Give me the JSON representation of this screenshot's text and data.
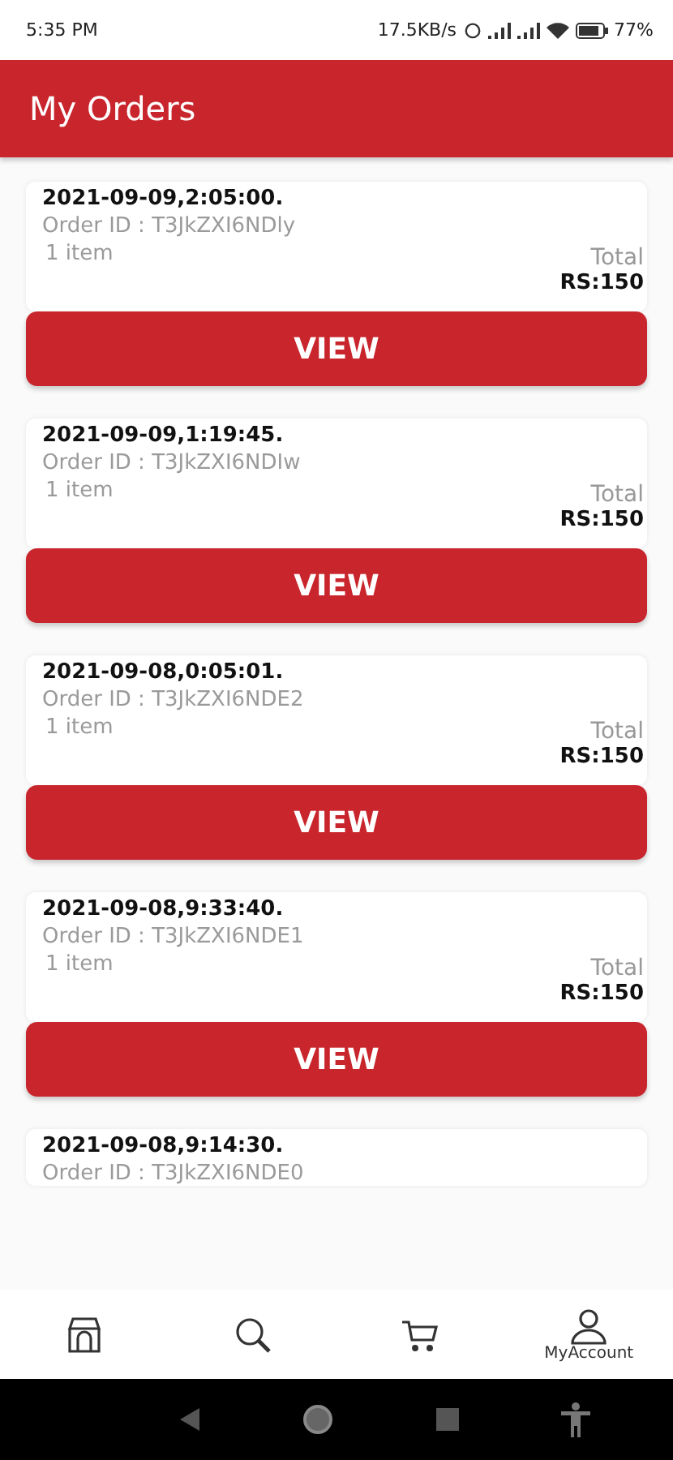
{
  "status_bar": {
    "time": "5:35 PM",
    "speed": "17.5KB/s",
    "battery": "77%"
  },
  "header": {
    "title": "My Orders"
  },
  "orders": [
    {
      "date": "2021-09-09,2:05:00.",
      "order_id": "Order ID : T3JkZXI6NDly",
      "items": "1 item",
      "total_label": "Total",
      "total": "RS:150",
      "button": "VIEW"
    },
    {
      "date": "2021-09-09,1:19:45.",
      "order_id": "Order ID : T3JkZXI6NDIw",
      "items": "1 item",
      "total_label": "Total",
      "total": "RS:150",
      "button": "VIEW"
    },
    {
      "date": "2021-09-08,0:05:01.",
      "order_id": "Order ID : T3JkZXI6NDE2",
      "items": "1 item",
      "total_label": "Total",
      "total": "RS:150",
      "button": "VIEW"
    },
    {
      "date": "2021-09-08,9:33:40.",
      "order_id": "Order ID : T3JkZXI6NDE1",
      "items": "1 item",
      "total_label": "Total",
      "total": "RS:150",
      "button": "VIEW"
    },
    {
      "date": "2021-09-08,9:14:30.",
      "order_id": "Order ID : T3JkZXI6NDE0"
    }
  ],
  "bottom_nav": [
    {
      "kind": "store"
    },
    {
      "kind": "search"
    },
    {
      "kind": "cart"
    },
    {
      "kind": "account",
      "label": "MyAccount"
    }
  ]
}
